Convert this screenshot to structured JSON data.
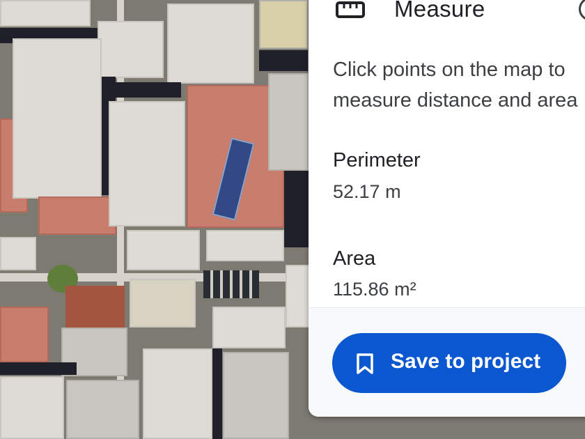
{
  "panel": {
    "title": "Measure",
    "description": "Click points on the map to measure distance and area",
    "perimeter_label": "Perimeter",
    "perimeter_value": "52.17 m",
    "area_label": "Area",
    "area_value": "115.86 m²",
    "save_button_label": "Save to project",
    "icons": [
      "ruler-icon",
      "help-icon",
      "bookmark-icon"
    ],
    "accent_color": "#0b57d0"
  }
}
